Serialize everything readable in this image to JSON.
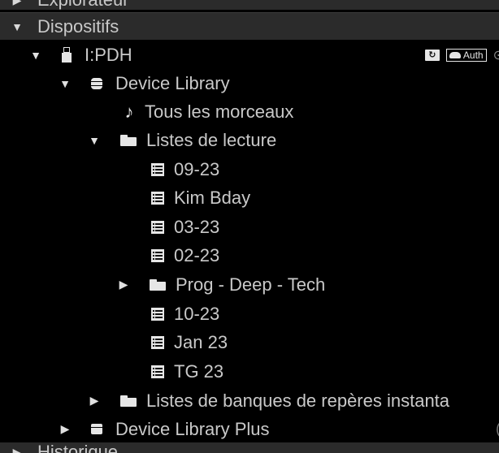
{
  "sections": {
    "top_label": "Explorateur",
    "devices_label": "Dispositifs",
    "bottom_label": "Historique"
  },
  "device": {
    "name": "I:PDH",
    "sync_badge": "↻",
    "auth_badge": "Auth",
    "edge_glyph": "⊙"
  },
  "tree": {
    "device_library": "Device Library",
    "all_tracks": "Tous les morceaux",
    "playlists_folder": "Listes de lecture",
    "playlists": [
      "09-23",
      "Kim Bday",
      "03-23",
      "02-23"
    ],
    "subfolder": "Prog - Deep - Tech",
    "playlists_after": [
      "10-23",
      "Jan 23",
      "TG 23"
    ],
    "hotcue_banks": "Listes de banques de repères instanta",
    "device_library_plus": "Device Library Plus",
    "dlp_edge": "("
  },
  "icons": {
    "note": "♪",
    "expanded": "▼",
    "collapsed": "▶"
  }
}
